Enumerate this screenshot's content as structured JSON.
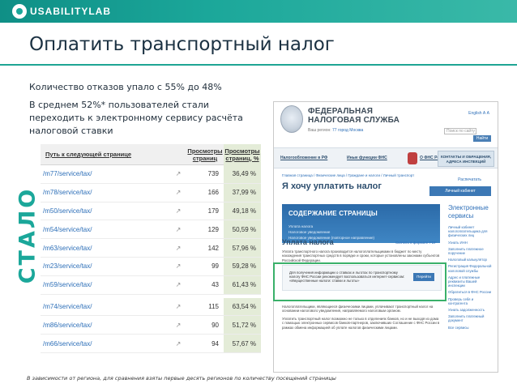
{
  "brand": {
    "logo": "USABILITYLAB"
  },
  "slide": {
    "title": "Оплатить транспортный налог",
    "line1": "Количество отказов упало с 55% до 48%",
    "line2": "В среднем 52%* пользователей стали переходить к электронному сервису расчёта налоговой ставки",
    "vertical_label": "СТАЛО",
    "footnote": "В зависимости от региона, для сравнения взяты первые десять регионов по количеству посещений страницы"
  },
  "table": {
    "headers": {
      "path": "Путь к следующей странице",
      "views": "Просмотры страниц",
      "percent": "Просмотры страниц, %"
    },
    "rows": [
      {
        "path": "/m77/service/tax/",
        "views": "739",
        "percent": "36,49 %"
      },
      {
        "path": "/m78/service/tax/",
        "views": "166",
        "percent": "37,99 %"
      },
      {
        "path": "/m50/service/tax/",
        "views": "179",
        "percent": "49,18 %"
      },
      {
        "path": "/m54/service/tax/",
        "views": "129",
        "percent": "50,59 %"
      },
      {
        "path": "/m63/service/tax/",
        "views": "142",
        "percent": "57,96 %"
      },
      {
        "path": "/m23/service/tax/",
        "views": "99",
        "percent": "59,28 %"
      },
      {
        "path": "/m59/service/tax/",
        "views": "43",
        "percent": "61,43 %"
      },
      {
        "path": "/m74/service/tax/",
        "views": "115",
        "percent": "63,54 %"
      },
      {
        "path": "/m86/service/tax/",
        "views": "90",
        "percent": "51,72 %"
      },
      {
        "path": "/m66/service/tax/",
        "views": "94",
        "percent": "57,67 %"
      }
    ]
  },
  "website": {
    "title": "ФЕДЕРАЛЬНАЯ НАЛОГОВАЯ СЛУЖБА",
    "region_label": "Ваш регион:",
    "region_value": "77 город Москва",
    "top_links": "English  А А",
    "search_placeholder": "Поиск по сайту",
    "search_button": "Найти",
    "nav": [
      "Налогообложение в РФ",
      "Иные функции ФНС",
      "О ФНС России"
    ],
    "nav_button": "КОНТАКТЫ И ОБРАЩЕНИЯ, АДРЕСА ИНСПЕКЦИЙ",
    "breadcrumb": "Главная страница / Физические лица / Граждане и налоги / Личный транспорт",
    "heading": "Я хочу уплатить налог",
    "print_link": "Распечатать",
    "side_button": "Личный кабинет",
    "toc_title": "СОДЕРЖАНИЕ СТРАНИЦЫ",
    "toc_links": [
      "Уплата налога",
      "Налоговое уведомление",
      "Налоговое уведомление (повторное направление)"
    ],
    "side_title": "Электронные сервисы",
    "side_links": [
      "Личный кабинет налогоплательщика для физических лиц",
      "Узнать ИНН",
      "Заполнить платежное поручение",
      "Налоговый калькулятор",
      "Регистрация Федеральной налоговой службы",
      "Адрес и платежные реквизиты Вашей инспекции",
      "Обратиться в ФНС России",
      "Проверь себя и контрагента",
      "Узнать задолженность",
      "Заполнить платежный документ",
      "Все сервисы"
    ],
    "section_title": "Уплата налога",
    "pdf_link": "Скачать в формате PDF",
    "para1": "Уплата транспортного налога производится налогоплательщиками в бюджет по месту нахождения транспортных средств в порядке и сроки, которые установлены законами субъектов Российской Федерации.",
    "notice_text": "Для получения информации о ставках и льготах по транспортному налогу ФНС России рекомендует воспользоваться интернет-сервисом: «Имущественные налоги: ставки и льготы»",
    "notice_button": "Перейти",
    "para2": "Налогоплательщики, являющиеся физическими лицами, уплачивают транспортный налог на основании налогового уведомления, направляемого налоговым органом.",
    "para3": "Уплатить транспортный налог возможно не только в отделениях банков, но и не выходя из дома с помощью электронных сервисов банков-партнеров, заключивших Соглашение с ФНС России в рамках обмена информацией об уплате налогов физическими лицами."
  },
  "colors": {
    "accent": "#1ba79a",
    "highlight": "#3ab06a",
    "table_percent_bg": "#e4ecd8"
  }
}
